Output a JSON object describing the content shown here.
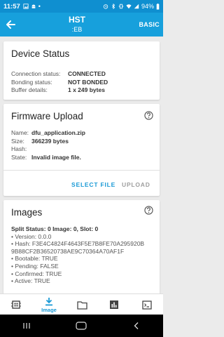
{
  "status_bar": {
    "time": "11:57",
    "battery": "94%"
  },
  "app_bar": {
    "title": "HST",
    "subtitle": ":EB",
    "menu": "BASIC"
  },
  "device_status": {
    "title": "Device Status",
    "rows": [
      {
        "key": "Connection status:",
        "value": "CONNECTED"
      },
      {
        "key": "Bonding status:",
        "value": "NOT BONDED"
      },
      {
        "key": "Buffer details:",
        "value": "1 x 249 bytes"
      }
    ]
  },
  "firmware_upload": {
    "title": "Firmware Upload",
    "rows": [
      {
        "key": "Name:",
        "value": "dfu_application.zip"
      },
      {
        "key": "Size:",
        "value": "366239 bytes"
      },
      {
        "key": "Hash:",
        "value": ""
      },
      {
        "key": "State:",
        "value": "Invalid image file."
      }
    ],
    "select_file": "SELECT FILE",
    "upload": "UPLOAD"
  },
  "images": {
    "title": "Images",
    "split_status": "Split Status: 0",
    "image_slot": "Image: 0, Slot: 0",
    "details": [
      "• Version: 0.0.0",
      "• Hash: F3E4C4824F4643F5E7B8FE70A295920B",
      "9B88CF2B36520738AE9C70364A70AF1F",
      "• Bootable: TRUE",
      "• Pending: FALSE",
      "• Confirmed: TRUE",
      "• Active: TRUE"
    ]
  },
  "bottom_nav": {
    "active_label": "Image"
  },
  "colors": {
    "primary": "#17a0dc",
    "status_bar": "#0f8fd0",
    "accent": "#1a9ad6"
  }
}
